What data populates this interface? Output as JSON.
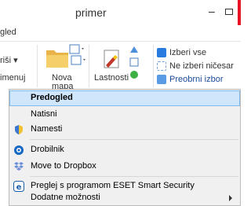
{
  "window": {
    "title": "primer",
    "minimize_glyph": "–"
  },
  "tabs": {
    "partial_label": "gled"
  },
  "ribbon": {
    "left_label_1": "riši ▾",
    "left_label_2": "imenuj",
    "new_folder_line1": "Nova",
    "new_folder_line2": "mapa",
    "properties_label": "Lastnosti",
    "select_all": "Izberi vse",
    "select_none": "Ne izberi ničesar",
    "invert_selection": "Preobrni izbor"
  },
  "context_menu": {
    "items": [
      {
        "label": "Predogled",
        "icon": "none"
      },
      {
        "label": "Natisni",
        "icon": "none"
      },
      {
        "label": "Namesti",
        "icon": "shield-icon"
      },
      {
        "label": "Drobilnik",
        "icon": "shredder-icon"
      },
      {
        "label": "Move to Dropbox",
        "icon": "dropbox-icon"
      },
      {
        "label": "Preglej s programom ESET Smart Security",
        "icon": "eset-icon"
      },
      {
        "label": "Dodatne možnosti",
        "icon": "none"
      }
    ]
  },
  "colors": {
    "highlight_bg": "#cfe6fb",
    "highlight_border": "#80b9ee",
    "menu_bg": "#f0f0f0",
    "close_red": "#e81123"
  }
}
